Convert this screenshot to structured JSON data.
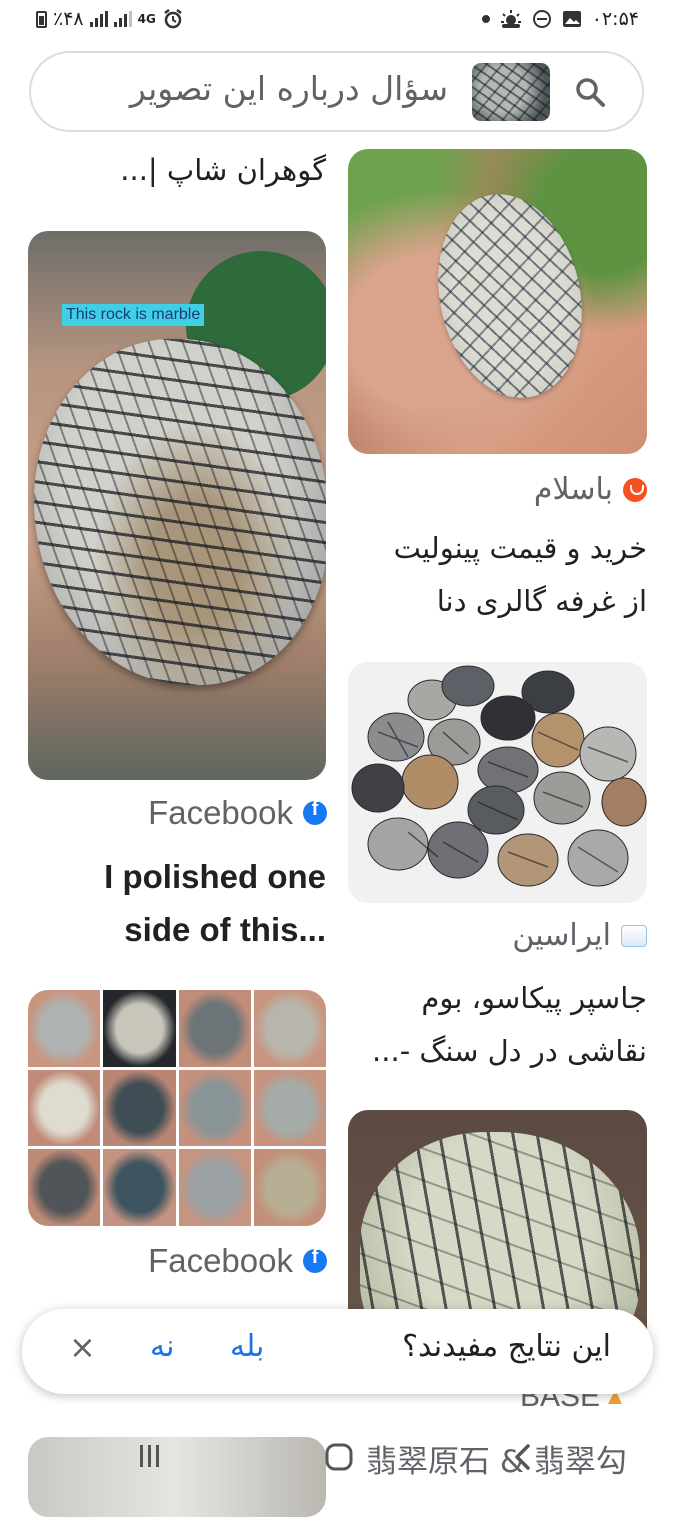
{
  "status_bar": {
    "battery": "٪۴۸",
    "network": "4G",
    "time": "۰۲:۵۴"
  },
  "search": {
    "text": "سؤال درباره این تصویر",
    "icon": "search-icon"
  },
  "results": [
    {
      "title": "گوهران شاپ |..."
    },
    {
      "source": "باسلام",
      "title_line1": "خرید و قیمت پینولیت",
      "title_line2": "از غرفه گالری دنا"
    },
    {
      "source": "Facebook",
      "overlay": "This rock is marble",
      "title_line1": "I polished one",
      "title_line2": "...side of this"
    },
    {
      "source": "ایراسین",
      "title_line1": "جاسپر پیکاسو، بوم",
      "title_line2": "نقاشی در دل سنگ -..."
    },
    {
      "source": "Facebook"
    },
    {
      "partial_text": "BASE"
    },
    {
      "partial_text": "翡翠原石 & 翡翠勾"
    }
  ],
  "feedback": {
    "question": "این نتایج مفیدند؟",
    "yes": "بله",
    "no": "نه",
    "close": "×"
  },
  "colors": {
    "link_blue": "#1a73e8",
    "text": "#202124",
    "secondary": "#5f6368",
    "facebook": "#1877f2"
  }
}
